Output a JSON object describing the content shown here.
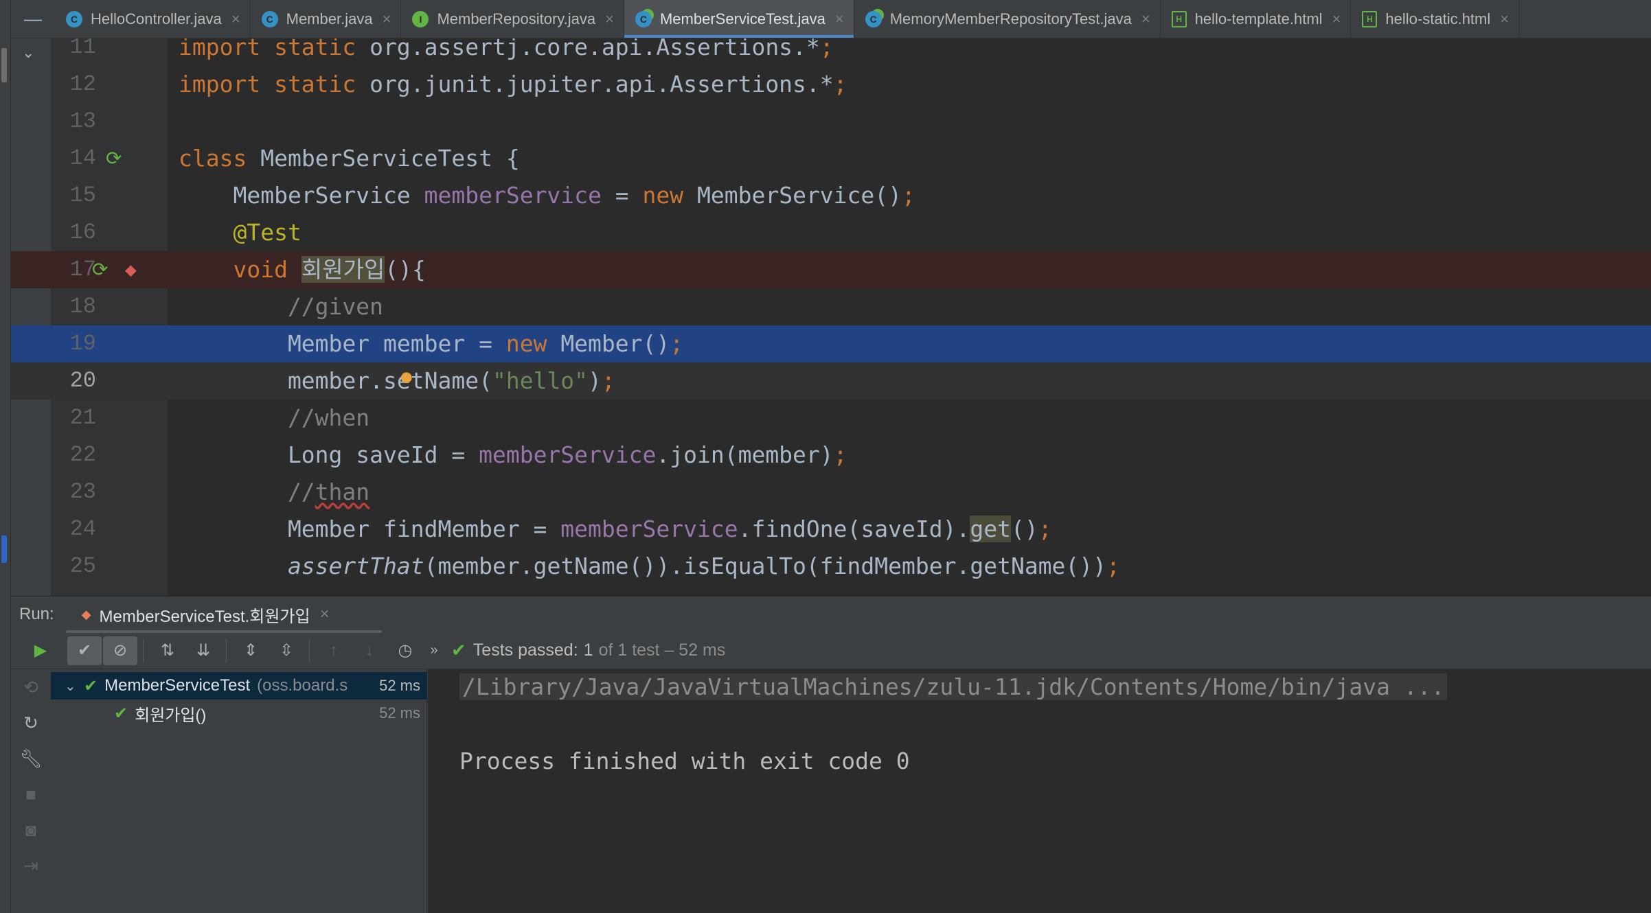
{
  "tabs": [
    {
      "label": "HelloController.java",
      "icon": "class-file-icon",
      "active": false
    },
    {
      "label": "Member.java",
      "icon": "class-file-icon",
      "active": false
    },
    {
      "label": "MemberRepository.java",
      "icon": "interface-file-icon",
      "active": false
    },
    {
      "label": "MemberServiceTest.java",
      "icon": "test-class-file-icon",
      "active": true
    },
    {
      "label": "MemoryMemberRepositoryTest.java",
      "icon": "test-class-file-icon",
      "active": false
    },
    {
      "label": "hello-template.html",
      "icon": "html-file-icon",
      "active": false
    },
    {
      "label": "hello-static.html",
      "icon": "html-file-icon",
      "active": false
    }
  ],
  "editor": {
    "lines": [
      {
        "num": "11",
        "text": "import static org.assertj.core.api.Assertions.*;"
      },
      {
        "num": "12",
        "text": "import static org.junit.jupiter.api.Assertions.*;"
      },
      {
        "num": "13",
        "text": ""
      },
      {
        "num": "14",
        "text": "class MemberServiceTest {"
      },
      {
        "num": "15",
        "text": "    MemberService memberService = new MemberService();"
      },
      {
        "num": "16",
        "text": "    @Test"
      },
      {
        "num": "17",
        "text": "    void 회원가입(){"
      },
      {
        "num": "18",
        "text": "        //given"
      },
      {
        "num": "19",
        "text": "        Member member = new Member();"
      },
      {
        "num": "20",
        "text": "        member.setName(\"hello\");"
      },
      {
        "num": "21",
        "text": "        //when"
      },
      {
        "num": "22",
        "text": "        Long saveId = memberService.join(member);"
      },
      {
        "num": "23",
        "text": "        //than"
      },
      {
        "num": "24",
        "text": "        Member findMember = memberService.findOne(saveId).get();"
      },
      {
        "num": "25",
        "text": "        assertThat(member.getName()).isEqualTo(findMember.getName());"
      }
    ]
  },
  "run": {
    "label": "Run:",
    "tab_label": "MemberServiceTest.회원가입",
    "status_passed": "Tests passed:",
    "status_count": "1",
    "status_rest": "of 1 test – 52 ms",
    "tree": [
      {
        "name": "MemberServiceTest",
        "pkg": "(oss.board.s",
        "time": "52 ms"
      },
      {
        "name": "회원가입()",
        "time": "52 ms"
      }
    ],
    "console": [
      "/Library/Java/JavaVirtualMachines/zulu-11.jdk/Contents/Home/bin/java ...",
      "",
      "Process finished with exit code 0"
    ]
  },
  "colors": {
    "keyword": "#cc7832",
    "field": "#9876aa",
    "annotation": "#bbb529",
    "comment": "#808080",
    "string": "#6a8759",
    "selection": "#214283",
    "success": "#62b543"
  }
}
